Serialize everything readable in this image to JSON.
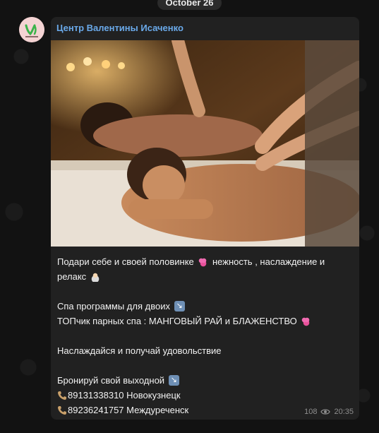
{
  "date_separator": "October 26",
  "channel": {
    "name": "Центр Валентины Исаченко",
    "avatar_text": "Body Clinic"
  },
  "post": {
    "photo_description": "spa couples massage photo",
    "lines": [
      {
        "text": "Подари себе и своей половинке ",
        "emoji": "hearts",
        "tail": " нежность , наслаждение и"
      },
      {
        "text": "релакс ",
        "emoji": "person",
        "tail": ""
      },
      {
        "text": "",
        "emoji": "",
        "tail": ""
      },
      {
        "text": "Спа программы для двоих ",
        "emoji": "arrow",
        "tail": ""
      },
      {
        "text": "ТОПчик парных спа : МАНГОВЫЙ РАЙ и БЛАЖЕНСТВО ",
        "emoji": "hearts",
        "tail": ""
      },
      {
        "text": "",
        "emoji": "",
        "tail": ""
      },
      {
        "text": "Наслаждайся и получай удовольствие",
        "emoji": "",
        "tail": ""
      },
      {
        "text": "",
        "emoji": "",
        "tail": ""
      },
      {
        "text": "Бронируй свой выходной ",
        "emoji": "arrow",
        "tail": ""
      },
      {
        "text": "89131338310 Новокузнецк",
        "emoji": "phone",
        "tail": ""
      },
      {
        "text": "89236241757 Междуреченск",
        "emoji": "phone",
        "tail": ""
      }
    ],
    "views": "108",
    "time": "20:35"
  },
  "colors": {
    "background": "#121212",
    "bubble": "#212121",
    "sender_name": "#6aa9e9",
    "text": "#f2f2f2",
    "meta": "#8e8e8e"
  },
  "icons": {
    "views": "eye-icon",
    "phone": "telephone-receiver-icon",
    "arrow": "down-right-arrow-icon"
  }
}
